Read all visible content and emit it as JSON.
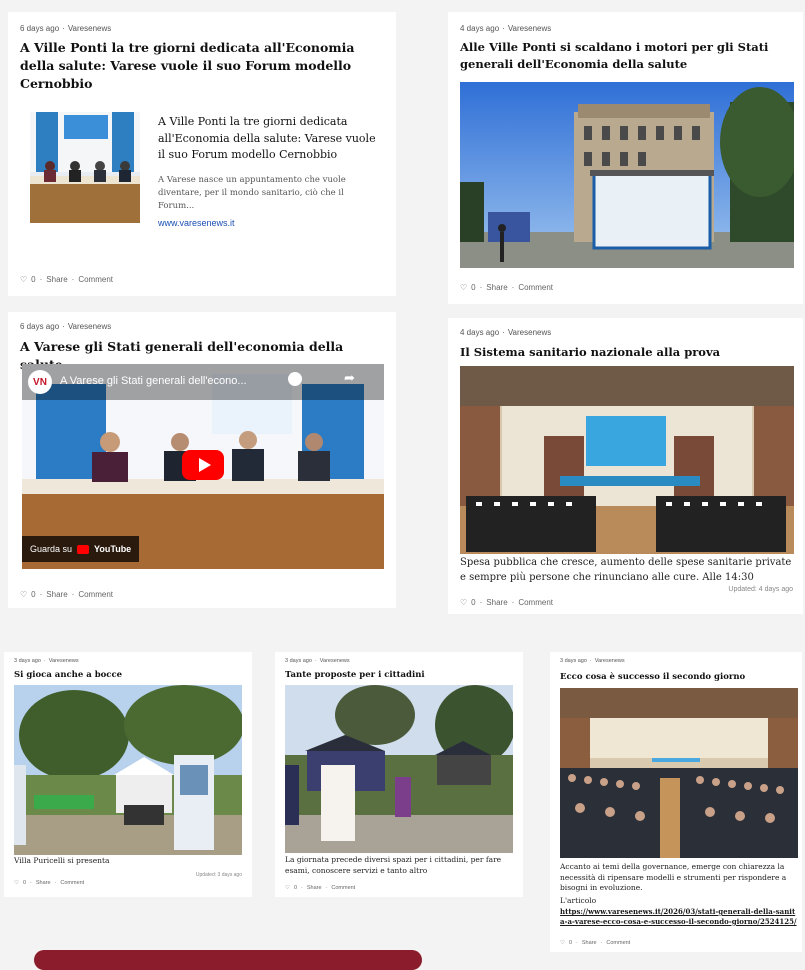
{
  "posts": [
    {
      "meta": {
        "age": "6 days ago",
        "author": "Varesenews"
      },
      "title": "A Ville Ponti la tre giorni dedicata all'Economia della salute: Varese vuole il suo Forum modello Cernobbio",
      "link_preview": {
        "title": "A Ville Ponti la tre giorni dedicata all'Economia della salute: Varese vuole il suo Forum modello Cernobbio",
        "excerpt": "A Varese nasce un appuntamento che vuole diventare, per il mondo sanitario, ciò che il Forum...",
        "domain": "www.varesenews.it"
      },
      "footer": {
        "likes": "0",
        "share": "Share",
        "comment": "Comment"
      }
    },
    {
      "meta": {
        "age": "4 days ago",
        "author": "Varesenews"
      },
      "title": "Alle Ville Ponti si scaldano i motori per gli Stati generali dell'Economia della salute",
      "footer": {
        "likes": "0",
        "share": "Share",
        "comment": "Comment"
      }
    },
    {
      "meta": {
        "age": "6 days ago",
        "author": "Varesenews"
      },
      "title": "A Varese gli Stati generali dell'economia della salute",
      "video": {
        "channel_initials": "VN",
        "title": "A Varese gli Stati generali dell'econo...",
        "watch_label": "Guarda su",
        "platform": "YouTube",
        "share_label": "Condividi"
      },
      "footer": {
        "likes": "0",
        "share": "Share",
        "comment": "Comment"
      }
    },
    {
      "meta": {
        "age": "4 days ago",
        "author": "Varesenews"
      },
      "title": "Il Sistema sanitario nazionale alla prova",
      "caption": "Spesa pubblica che cresce, aumento delle spese sanitarie private e sempre più persone che rinunciano alle cure. Alle 14:30",
      "updated": "Updated: 4 days ago",
      "footer": {
        "likes": "0",
        "share": "Share",
        "comment": "Comment"
      }
    },
    {
      "meta": {
        "age": "3 days ago",
        "author": "Varesenews"
      },
      "title": "Si gioca anche a bocce",
      "caption": "Villa Puricelli si presenta",
      "updated": "Updated: 3 days ago",
      "footer": {
        "likes": "0",
        "share": "Share",
        "comment": "Comment"
      }
    },
    {
      "meta": {
        "age": "3 days ago",
        "author": "Varesenews"
      },
      "title": "Tante proposte per i cittadini",
      "caption": "La giornata precede diversi spazi per i cittadini, per fare esami, conoscere servizi e tanto altro",
      "footer": {
        "likes": "0",
        "share": "Share",
        "comment": "Comment"
      }
    },
    {
      "meta": {
        "age": "3 days ago",
        "author": "Varesenews"
      },
      "title": "Ecco cosa è successo il secondo giorno",
      "caption": "Accanto ai temi della governance, emerge con chiarezza la necessità di ripensare modelli e strumenti per rispondere a bisogni in evoluzione.",
      "caption_label": "L'articolo",
      "caption_link": "https://www.varesenews.it/2026/03/stati-generali-della-sanita-a-varese-ecco-cosa-e-successo-il-secondo-giorno/2524125/",
      "footer": {
        "likes": "0",
        "share": "Share",
        "comment": "Comment"
      }
    }
  ],
  "colors": {
    "accent_button": "#8b1c2b",
    "link": "#1a4fb5",
    "youtube_red": "#ff0000"
  }
}
